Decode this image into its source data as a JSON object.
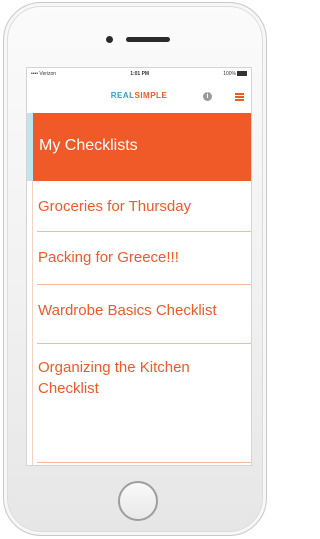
{
  "status_bar": {
    "carrier": "•••• Verizon",
    "time": "1:01 PM",
    "battery": "100%"
  },
  "app_bar": {
    "logo_real": "REAL",
    "logo_simple": "SIMPLE",
    "info_icon": "info-icon",
    "menu_icon": "hamburger-menu-icon",
    "accent_color": "#f05a28",
    "brand_blue": "#2da4c9"
  },
  "active_item": {
    "label": "My Checklists"
  },
  "checklists": [
    {
      "label": "Groceries for Thursday"
    },
    {
      "label": "Packing for Greece!!!"
    },
    {
      "label": "Wardrobe Basics Checklist"
    },
    {
      "label": "Organizing the Kitchen Checklist"
    }
  ]
}
